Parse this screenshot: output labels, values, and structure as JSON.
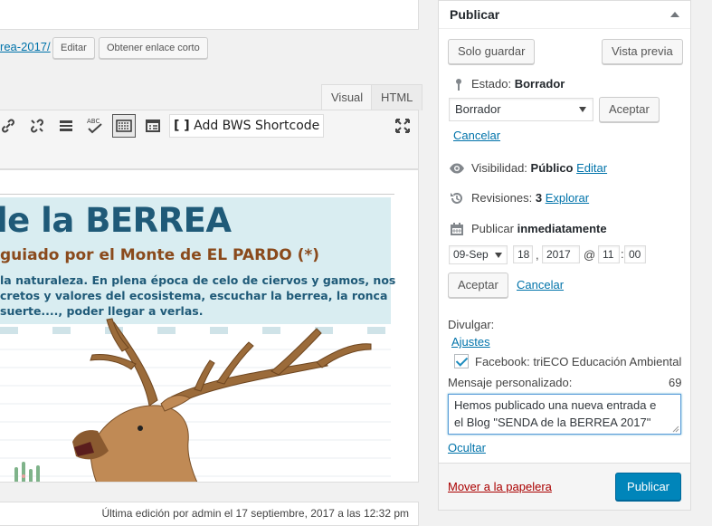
{
  "permalink": {
    "slug_fragment": "rea-2017/",
    "edit_label": "Editar",
    "shortlink_label": "Obtener enlace corto"
  },
  "editor": {
    "tab_visual": "Visual",
    "tab_html": "HTML",
    "bws_label": "Add BWS Shortcode",
    "poster": {
      "title": "le la BERREA",
      "subtitle": "guiado por el Monte de EL PARDO (*)",
      "lines": [
        "la naturaleza. En plena época de celo de ciervos y gamos, nos",
        "cretos y valores del ecosistema, escuchar la berrea, la ronca",
        "suerte...., poder llegar a verlas."
      ]
    },
    "status": "Última edición por admin el 17 septiembre, 2017 a las 12:32 pm"
  },
  "publish": {
    "title": "Publicar",
    "save_draft": "Solo guardar",
    "preview": "Vista previa",
    "status_label": "Estado:",
    "status_value": "Borrador",
    "status_select": "Borrador",
    "accept": "Aceptar",
    "cancel": "Cancelar",
    "visibility_label": "Visibilidad:",
    "visibility_value": "Público",
    "visibility_edit": "Editar",
    "revisions_label": "Revisiones:",
    "revisions_value": "3",
    "revisions_link": "Explorar",
    "publish_label": "Publicar",
    "publish_when": "inmediatamente",
    "date": {
      "month": "09-Sep",
      "day": "18",
      "year": "2017",
      "at": "@",
      "hour": "11",
      "minute": "00"
    },
    "accept2": "Aceptar",
    "cancel2": "Cancelar",
    "share_label": "Divulgar:",
    "settings_link": "Ajustes",
    "facebook_label": "Facebook: triECO Educación Ambiental",
    "custom_message_label": "Mensaje personalizado:",
    "char_count": "69",
    "message_line1": "Hemos publicado una nueva entrada e",
    "message_line2": "el Blog \"SENDA de la BERREA 2017\"",
    "hide_link": "Ocultar",
    "trash": "Mover a la papelera",
    "publish_button": "Publicar"
  },
  "colors": {
    "accent": "#0085ba",
    "link": "#0073aa",
    "trash": "#aa0000",
    "poster_blue": "#1f5a78",
    "poster_brown": "#8a4a1c"
  }
}
